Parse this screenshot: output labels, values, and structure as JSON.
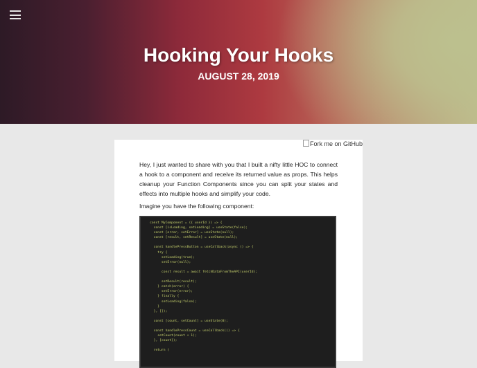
{
  "header": {
    "title": "Hooking Your Hooks",
    "date": "AUGUST 28, 2019"
  },
  "fork_label": "Fork me on GitHub",
  "post": {
    "intro": "Hey, I just wanted to share with you that I built a nifty little HOC to connect a hook to a component and receive its returned value as props. This helps cleanup your Function Components since you can split your states and effects into multiple hooks and simplify your code.",
    "lead": "Imagine you have the following component:",
    "code": [
      "const MyComponent = ({ userId }) => {",
      "  const [isLoading, setLoading] = useState(false);",
      "  const [error, setError] = useState(null);",
      "  const [result, setResult] = useState(null);",
      "",
      "  const handlePressButton = useCallback(async () => {",
      "    try {",
      "      setLoading(true);",
      "      setError(null);",
      "",
      "      const result = await fetchDataFromTheAPI(userId);",
      "",
      "      setResult(result);",
      "    } catch(error) {",
      "      setError(error);",
      "    } finally {",
      "      setLoading(false);",
      "    }",
      "  }, []);",
      "",
      "  const [count, setCount] = useState(0);",
      "",
      "  const handlePressCount = useCallback(() => {",
      "    setCount(count + 1);",
      "  }, [count]);",
      "",
      "  return ("
    ]
  }
}
